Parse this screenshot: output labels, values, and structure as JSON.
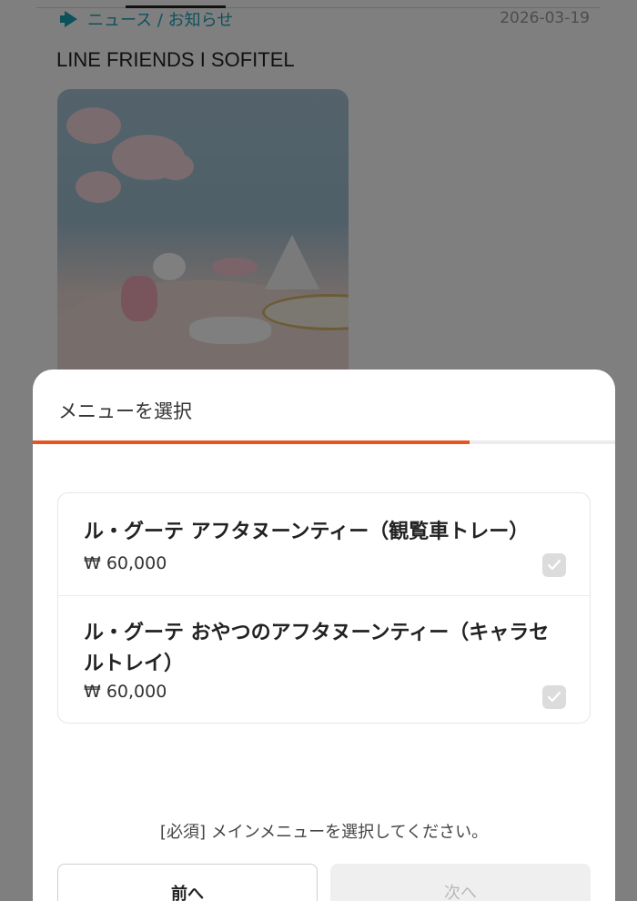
{
  "background": {
    "category_label": "ニュース / お知らせ",
    "date": "2026-03-19",
    "title": "LINE FRIENDS I SOFITEL"
  },
  "sheet": {
    "title": "メニューを選択",
    "progress_fraction": 0.75,
    "items": [
      {
        "name": "ル・グーテ アフタヌーンティー（観覧車トレー）",
        "price": "₩ 60,000"
      },
      {
        "name": "ル・グーテ おやつのアフタヌーンティー（キャラセルトレイ）",
        "price": "₩ 60,000"
      }
    ],
    "notice": "[必須] メインメニューを選択してください。",
    "prev_label": "前へ",
    "next_label": "次へ"
  },
  "colors": {
    "accent": "#e8541e",
    "category": "#1aa3b8"
  }
}
